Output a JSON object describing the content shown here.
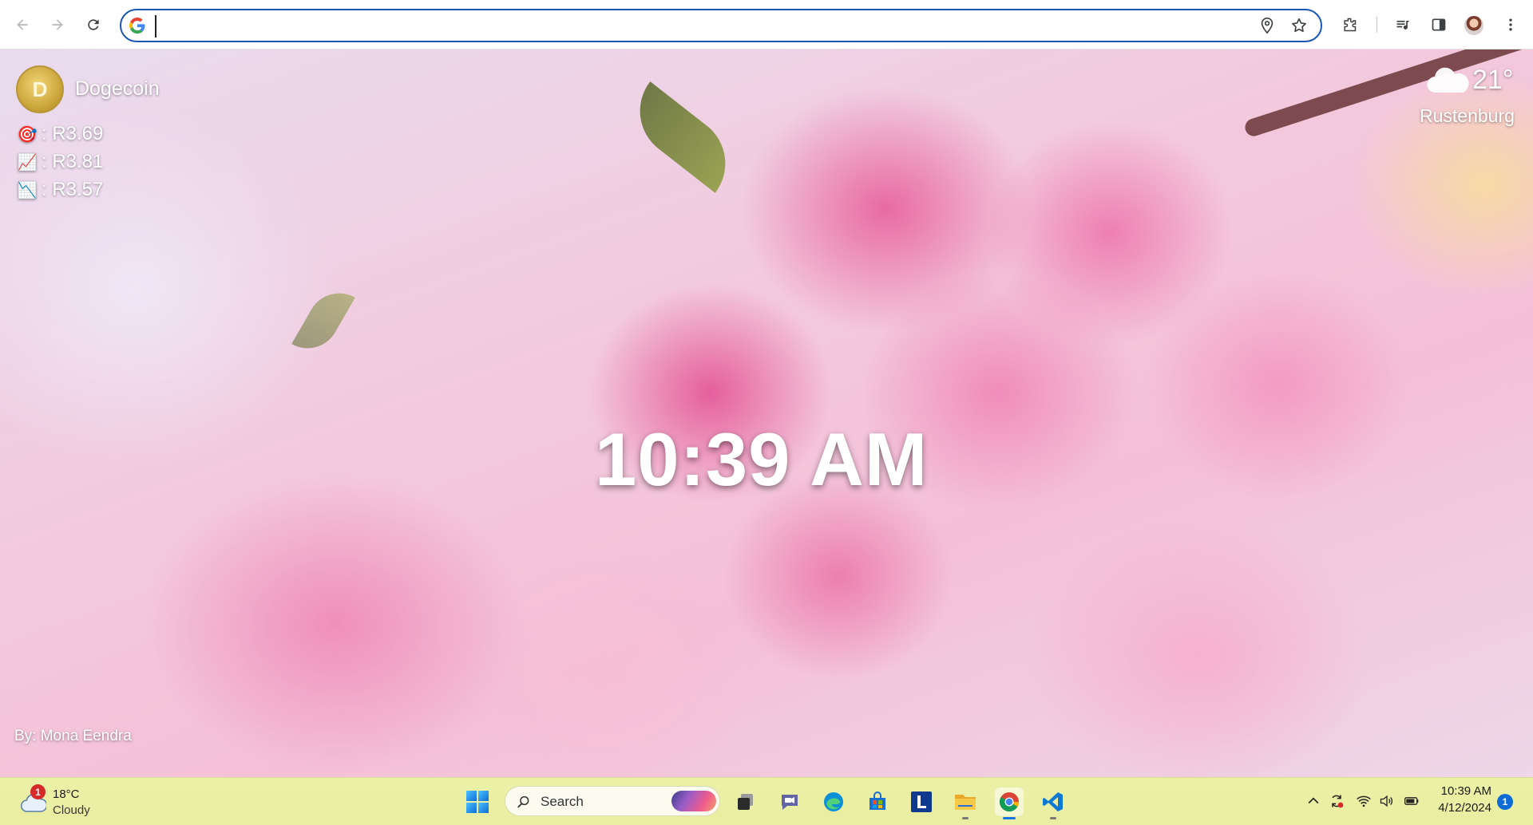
{
  "browser": {
    "omnibox": {
      "value": "",
      "placeholder": ""
    }
  },
  "newtab": {
    "crypto": {
      "coin_name": "Dogecoin",
      "coin_logo_letter": "D",
      "prices": [
        {
          "icon": "target-icon",
          "label": ": R3.69"
        },
        {
          "icon": "chart-up-icon",
          "label": ": R3.81"
        },
        {
          "icon": "chart-down-icon",
          "label": ": R3.57"
        }
      ]
    },
    "clock": "10:39 AM",
    "weather": {
      "temperature": "21°",
      "city": "Rustenburg"
    },
    "credit": "By: Mona Eendra"
  },
  "taskbar": {
    "weather": {
      "badge": "1",
      "temperature": "18°C",
      "condition": "Cloudy"
    },
    "search_label": "Search",
    "clock_time": "10:39 AM",
    "clock_date": "4/12/2024",
    "notification_count": "1",
    "pinned_apps": [
      "task-view",
      "teams-chat",
      "edge",
      "microsoft-store",
      "l-app",
      "file-explorer",
      "chrome",
      "vscode"
    ]
  },
  "colors": {
    "omnibox_border": "#1a57b5",
    "taskbar_bg": "#eaf0a6",
    "accent": "#1a73e8"
  }
}
